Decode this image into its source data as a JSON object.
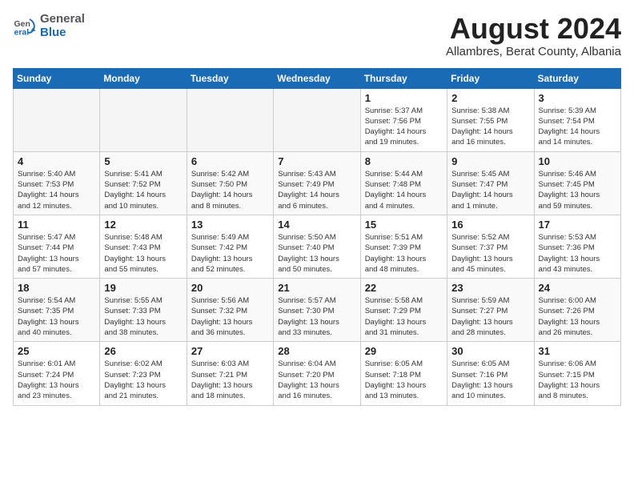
{
  "header": {
    "logo": {
      "general": "General",
      "blue": "Blue"
    },
    "title": "August 2024",
    "subtitle": "Allambres, Berat County, Albania"
  },
  "weekdays": [
    "Sunday",
    "Monday",
    "Tuesday",
    "Wednesday",
    "Thursday",
    "Friday",
    "Saturday"
  ],
  "weeks": [
    [
      {
        "day": "",
        "info": ""
      },
      {
        "day": "",
        "info": ""
      },
      {
        "day": "",
        "info": ""
      },
      {
        "day": "",
        "info": ""
      },
      {
        "day": "1",
        "info": "Sunrise: 5:37 AM\nSunset: 7:56 PM\nDaylight: 14 hours\nand 19 minutes."
      },
      {
        "day": "2",
        "info": "Sunrise: 5:38 AM\nSunset: 7:55 PM\nDaylight: 14 hours\nand 16 minutes."
      },
      {
        "day": "3",
        "info": "Sunrise: 5:39 AM\nSunset: 7:54 PM\nDaylight: 14 hours\nand 14 minutes."
      }
    ],
    [
      {
        "day": "4",
        "info": "Sunrise: 5:40 AM\nSunset: 7:53 PM\nDaylight: 14 hours\nand 12 minutes."
      },
      {
        "day": "5",
        "info": "Sunrise: 5:41 AM\nSunset: 7:52 PM\nDaylight: 14 hours\nand 10 minutes."
      },
      {
        "day": "6",
        "info": "Sunrise: 5:42 AM\nSunset: 7:50 PM\nDaylight: 14 hours\nand 8 minutes."
      },
      {
        "day": "7",
        "info": "Sunrise: 5:43 AM\nSunset: 7:49 PM\nDaylight: 14 hours\nand 6 minutes."
      },
      {
        "day": "8",
        "info": "Sunrise: 5:44 AM\nSunset: 7:48 PM\nDaylight: 14 hours\nand 4 minutes."
      },
      {
        "day": "9",
        "info": "Sunrise: 5:45 AM\nSunset: 7:47 PM\nDaylight: 14 hours\nand 1 minute."
      },
      {
        "day": "10",
        "info": "Sunrise: 5:46 AM\nSunset: 7:45 PM\nDaylight: 13 hours\nand 59 minutes."
      }
    ],
    [
      {
        "day": "11",
        "info": "Sunrise: 5:47 AM\nSunset: 7:44 PM\nDaylight: 13 hours\nand 57 minutes."
      },
      {
        "day": "12",
        "info": "Sunrise: 5:48 AM\nSunset: 7:43 PM\nDaylight: 13 hours\nand 55 minutes."
      },
      {
        "day": "13",
        "info": "Sunrise: 5:49 AM\nSunset: 7:42 PM\nDaylight: 13 hours\nand 52 minutes."
      },
      {
        "day": "14",
        "info": "Sunrise: 5:50 AM\nSunset: 7:40 PM\nDaylight: 13 hours\nand 50 minutes."
      },
      {
        "day": "15",
        "info": "Sunrise: 5:51 AM\nSunset: 7:39 PM\nDaylight: 13 hours\nand 48 minutes."
      },
      {
        "day": "16",
        "info": "Sunrise: 5:52 AM\nSunset: 7:37 PM\nDaylight: 13 hours\nand 45 minutes."
      },
      {
        "day": "17",
        "info": "Sunrise: 5:53 AM\nSunset: 7:36 PM\nDaylight: 13 hours\nand 43 minutes."
      }
    ],
    [
      {
        "day": "18",
        "info": "Sunrise: 5:54 AM\nSunset: 7:35 PM\nDaylight: 13 hours\nand 40 minutes."
      },
      {
        "day": "19",
        "info": "Sunrise: 5:55 AM\nSunset: 7:33 PM\nDaylight: 13 hours\nand 38 minutes."
      },
      {
        "day": "20",
        "info": "Sunrise: 5:56 AM\nSunset: 7:32 PM\nDaylight: 13 hours\nand 36 minutes."
      },
      {
        "day": "21",
        "info": "Sunrise: 5:57 AM\nSunset: 7:30 PM\nDaylight: 13 hours\nand 33 minutes."
      },
      {
        "day": "22",
        "info": "Sunrise: 5:58 AM\nSunset: 7:29 PM\nDaylight: 13 hours\nand 31 minutes."
      },
      {
        "day": "23",
        "info": "Sunrise: 5:59 AM\nSunset: 7:27 PM\nDaylight: 13 hours\nand 28 minutes."
      },
      {
        "day": "24",
        "info": "Sunrise: 6:00 AM\nSunset: 7:26 PM\nDaylight: 13 hours\nand 26 minutes."
      }
    ],
    [
      {
        "day": "25",
        "info": "Sunrise: 6:01 AM\nSunset: 7:24 PM\nDaylight: 13 hours\nand 23 minutes."
      },
      {
        "day": "26",
        "info": "Sunrise: 6:02 AM\nSunset: 7:23 PM\nDaylight: 13 hours\nand 21 minutes."
      },
      {
        "day": "27",
        "info": "Sunrise: 6:03 AM\nSunset: 7:21 PM\nDaylight: 13 hours\nand 18 minutes."
      },
      {
        "day": "28",
        "info": "Sunrise: 6:04 AM\nSunset: 7:20 PM\nDaylight: 13 hours\nand 16 minutes."
      },
      {
        "day": "29",
        "info": "Sunrise: 6:05 AM\nSunset: 7:18 PM\nDaylight: 13 hours\nand 13 minutes."
      },
      {
        "day": "30",
        "info": "Sunrise: 6:05 AM\nSunset: 7:16 PM\nDaylight: 13 hours\nand 10 minutes."
      },
      {
        "day": "31",
        "info": "Sunrise: 6:06 AM\nSunset: 7:15 PM\nDaylight: 13 hours\nand 8 minutes."
      }
    ]
  ]
}
